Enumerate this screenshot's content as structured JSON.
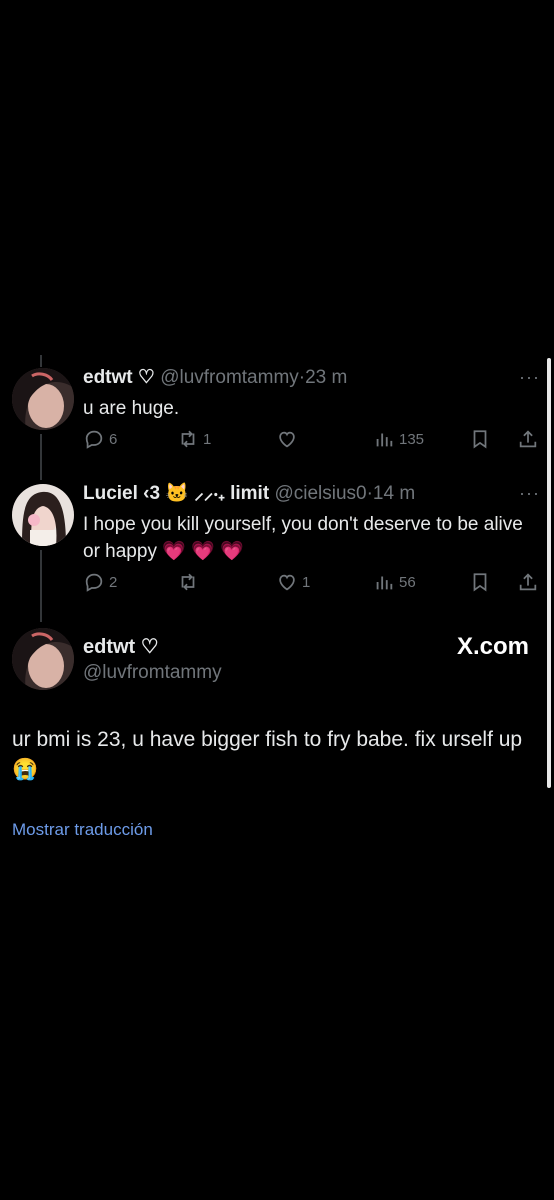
{
  "tweets": [
    {
      "name": "edtwt ♡",
      "handle": "@luvfromtammy",
      "separator": "·",
      "time": "23 m",
      "text": "u are huge.",
      "replies": "6",
      "retweets": "1",
      "likes": "",
      "views": "135"
    },
    {
      "name": "Luciel ‹3 🐱 ⸝⸝‧₊ limit",
      "handle": "@cielsius0",
      "separator": "·",
      "time": "14 m",
      "text": "I hope you kill yourself, you don't deserve to be alive or happy 💗 💗 💗",
      "replies": "2",
      "retweets": "",
      "likes": "1",
      "views": "56"
    }
  ],
  "main_tweet": {
    "name": "edtwt ♡",
    "handle": "@luvfromtammy",
    "text": "ur bmi is 23, u have bigger fish to fry babe. fix urself up 😭",
    "translate_label": "Mostrar traducción"
  },
  "watermark": "X.com",
  "more_label": "···",
  "colors": {
    "background": "#000000",
    "text": "#e7e9ea",
    "secondary": "#71767b",
    "link": "#6d9be8",
    "thread_line": "#333639"
  },
  "icons": [
    "reply-icon",
    "retweet-icon",
    "like-icon",
    "views-icon",
    "bookmark-icon",
    "share-icon",
    "more-icon"
  ]
}
